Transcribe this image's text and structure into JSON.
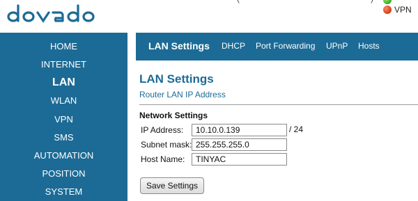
{
  "header": {
    "logo_text": "dovado",
    "partial_text_1": "(",
    "partial_text_2": ")",
    "status_indicators": [
      {
        "label": "",
        "color": "#3aa51d"
      },
      {
        "label": "VPN",
        "color": "#d23a12"
      }
    ]
  },
  "sidebar": {
    "items": [
      {
        "label": "HOME",
        "active": false
      },
      {
        "label": "INTERNET",
        "active": false
      },
      {
        "label": "LAN",
        "active": true
      },
      {
        "label": "WLAN",
        "active": false
      },
      {
        "label": "VPN",
        "active": false
      },
      {
        "label": "SMS",
        "active": false
      },
      {
        "label": "AUTOMATION",
        "active": false
      },
      {
        "label": "POSITION",
        "active": false
      },
      {
        "label": "SYSTEM",
        "active": false
      }
    ]
  },
  "tabs": [
    {
      "label": "LAN Settings",
      "active": true
    },
    {
      "label": "DHCP",
      "active": false
    },
    {
      "label": "Port Forwarding",
      "active": false
    },
    {
      "label": "UPnP",
      "active": false
    },
    {
      "label": "Hosts",
      "active": false
    }
  ],
  "content": {
    "title": "LAN Settings",
    "subtitle": "Router LAN IP Address",
    "section_title": "Network Settings",
    "fields": {
      "ip_label": "IP Address:",
      "ip_value": "10.10.0.139",
      "ip_suffix": "/ 24",
      "subnet_label": "Subnet mask:",
      "subnet_value": "255.255.255.0",
      "host_label": "Host Name:",
      "host_value": "TINYAC"
    },
    "save_label": "Save Settings"
  },
  "colors": {
    "brand_blue": "#1c6b96",
    "text_white": "#ffffff"
  }
}
